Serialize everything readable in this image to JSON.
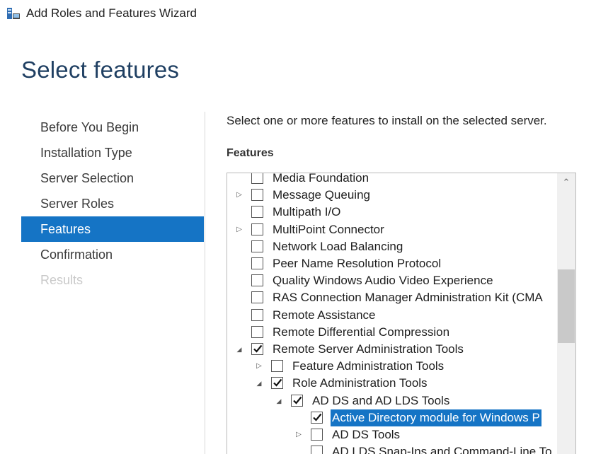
{
  "window": {
    "title": "Add Roles and Features Wizard",
    "icon": "server-manager-icon"
  },
  "page": {
    "title": "Select features",
    "instruction": "Select one or more features to install on the selected server.",
    "section_label": "Features"
  },
  "nav": {
    "items": [
      {
        "label": "Before You Begin",
        "state": "normal"
      },
      {
        "label": "Installation Type",
        "state": "normal"
      },
      {
        "label": "Server Selection",
        "state": "normal"
      },
      {
        "label": "Server Roles",
        "state": "normal"
      },
      {
        "label": "Features",
        "state": "active"
      },
      {
        "label": "Confirmation",
        "state": "normal"
      },
      {
        "label": "Results",
        "state": "disabled"
      }
    ]
  },
  "features": [
    {
      "label": "Media Foundation",
      "level": 0,
      "expander": "none",
      "checked": false
    },
    {
      "label": "Message Queuing",
      "level": 0,
      "expander": "collapsed",
      "checked": false
    },
    {
      "label": "Multipath I/O",
      "level": 0,
      "expander": "none",
      "checked": false
    },
    {
      "label": "MultiPoint Connector",
      "level": 0,
      "expander": "collapsed",
      "checked": false
    },
    {
      "label": "Network Load Balancing",
      "level": 0,
      "expander": "none",
      "checked": false
    },
    {
      "label": "Peer Name Resolution Protocol",
      "level": 0,
      "expander": "none",
      "checked": false
    },
    {
      "label": "Quality Windows Audio Video Experience",
      "level": 0,
      "expander": "none",
      "checked": false
    },
    {
      "label": "RAS Connection Manager Administration Kit (CMA",
      "level": 0,
      "expander": "none",
      "checked": false
    },
    {
      "label": "Remote Assistance",
      "level": 0,
      "expander": "none",
      "checked": false
    },
    {
      "label": "Remote Differential Compression",
      "level": 0,
      "expander": "none",
      "checked": false
    },
    {
      "label": "Remote Server Administration Tools",
      "level": 0,
      "expander": "expanded",
      "checked": true
    },
    {
      "label": "Feature Administration Tools",
      "level": 1,
      "expander": "collapsed",
      "checked": false
    },
    {
      "label": "Role Administration Tools",
      "level": 1,
      "expander": "expanded",
      "checked": true
    },
    {
      "label": "AD DS and AD LDS Tools",
      "level": 2,
      "expander": "expanded",
      "checked": true
    },
    {
      "label": "Active Directory module for Windows P",
      "level": 3,
      "expander": "none",
      "checked": true,
      "selected": true
    },
    {
      "label": "AD DS Tools",
      "level": 3,
      "expander": "collapsed",
      "checked": false
    },
    {
      "label": "AD LDS Snap-Ins and Command-Line To",
      "level": 3,
      "expander": "none",
      "checked": false
    }
  ],
  "colors": {
    "accent": "#1574c5",
    "title": "#1f3f62"
  }
}
